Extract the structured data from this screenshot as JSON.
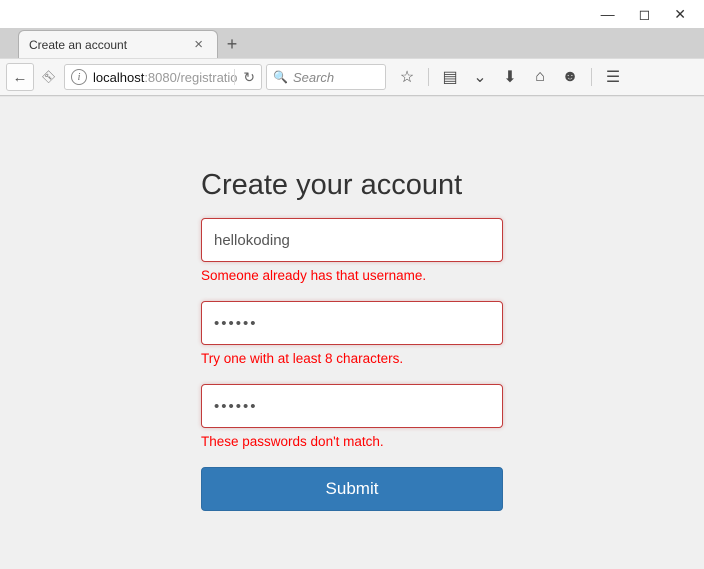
{
  "window": {
    "minimize": "—",
    "maximize": "◻",
    "close": "✕"
  },
  "tab": {
    "title": "Create an account",
    "close": "×",
    "new": "+"
  },
  "toolbar": {
    "back": "←",
    "url_host": "localhost",
    "url_path": ":8080/registratio",
    "reload": "↻",
    "search_placeholder": "Search"
  },
  "form": {
    "title": "Create your account",
    "username_value": "hellokoding",
    "username_error": "Someone already has that username.",
    "password_value": "••••••",
    "password_error": "Try one with at least 8 characters.",
    "confirm_value": "••••••",
    "confirm_error": "These passwords don't match.",
    "submit_label": "Submit"
  }
}
